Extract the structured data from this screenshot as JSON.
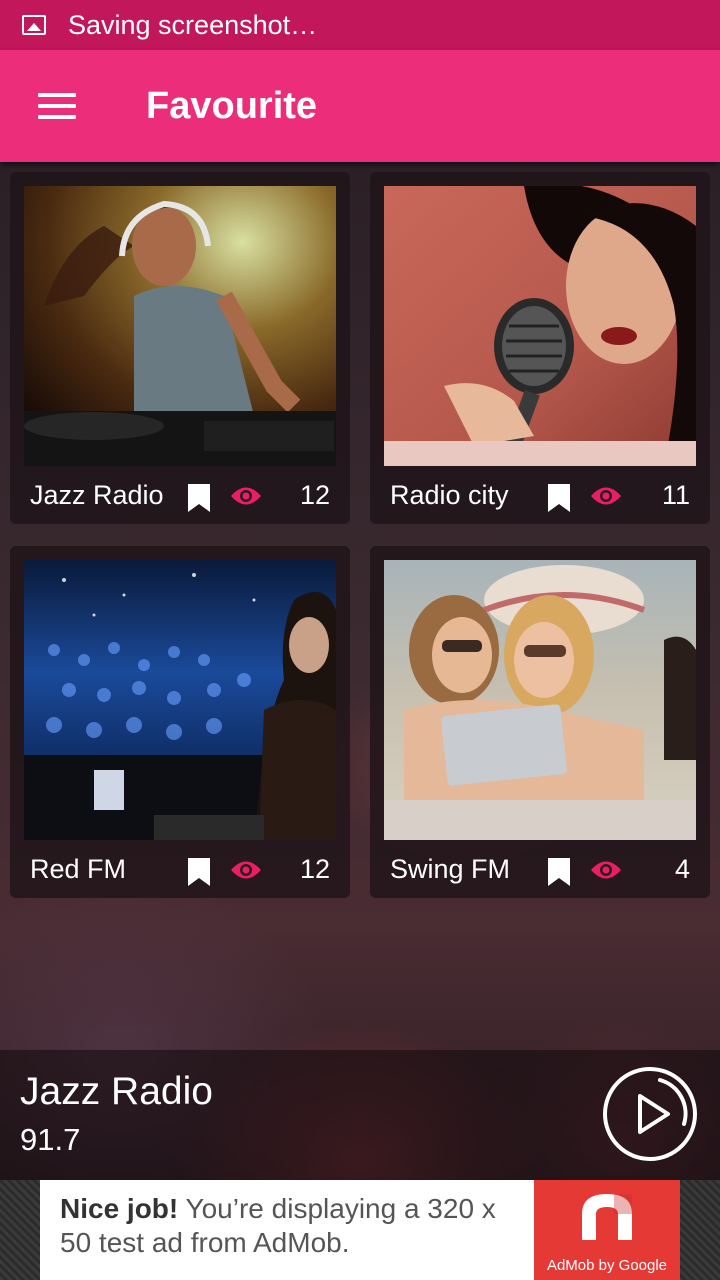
{
  "status_bar": {
    "text": "Saving screenshot…",
    "icon": "image-icon"
  },
  "app_bar": {
    "title": "Favourite",
    "menu_icon": "hamburger-menu-icon"
  },
  "stations": [
    {
      "name": "Jazz Radio",
      "views": "12"
    },
    {
      "name": "Radio city",
      "views": "11"
    },
    {
      "name": "Red FM",
      "views": "12"
    },
    {
      "name": "Swing FM",
      "views": "4"
    }
  ],
  "now_playing": {
    "title": "Jazz Radio",
    "frequency": "91.7"
  },
  "ad": {
    "headline": "Nice job!",
    "body": " You’re displaying a 320 x 50 test ad from AdMob.",
    "logo_caption": "AdMob by Google"
  },
  "colors": {
    "status_bar": "#c2185b",
    "app_bar": "#ec2d7a",
    "accent": "#e91e63",
    "ad_logo": "#e53935"
  }
}
